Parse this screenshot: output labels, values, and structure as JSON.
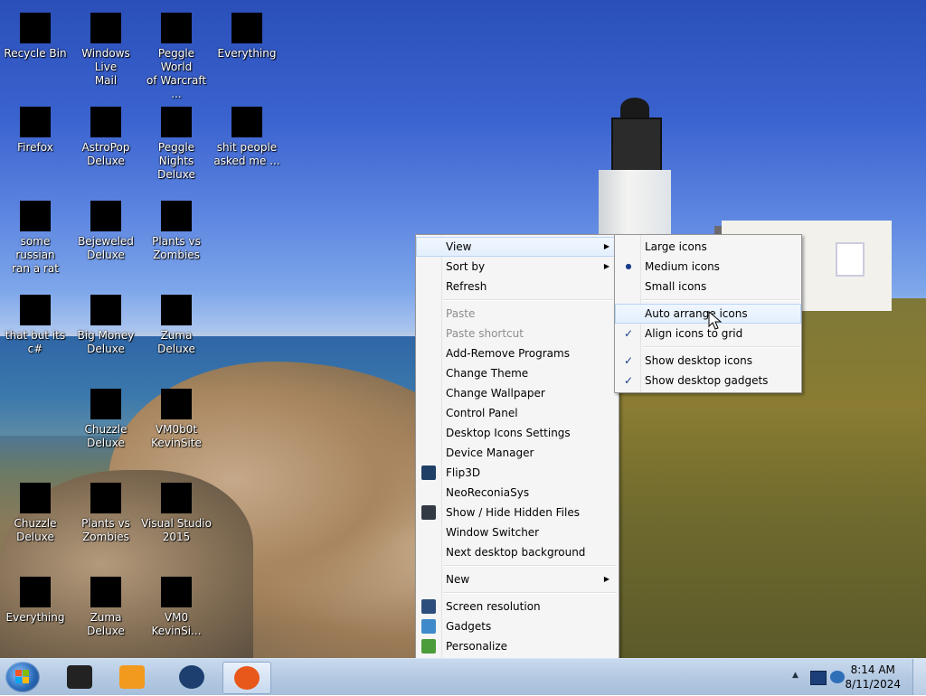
{
  "desktop_icons": [
    {
      "name": "Recycle Bin",
      "color": "#1b1b1b"
    },
    {
      "name": "Windows Live\nMail",
      "color": "#000000"
    },
    {
      "name": "Peggle World\nof Warcraft ...",
      "color": "#d87a1a"
    },
    {
      "name": "Everything",
      "color": "#f07a18"
    },
    {
      "name": "Firefox",
      "color": "#e8741a"
    },
    {
      "name": "AstroPop\nDeluxe",
      "color": "#c62a2a"
    },
    {
      "name": "Peggle Nights\nDeluxe",
      "color": "#3b84c9"
    },
    {
      "name": "shit people\nasked me ...",
      "color": "#777777"
    },
    {
      "name": "some russian\nran a rat",
      "color": "#e8a21a"
    },
    {
      "name": "Bejeweled\nDeluxe",
      "color": "#2a9bd8"
    },
    {
      "name": "Plants vs\nZombies",
      "color": "#6aa84f"
    },
    {
      "name": "that but its c#",
      "color": "#888888"
    },
    {
      "name": "Big Money\nDeluxe",
      "color": "#c8a23a"
    },
    {
      "name": "Zuma Deluxe",
      "color": "#d89a22"
    },
    {
      "name": "Chuzzle\nDeluxe",
      "color": "#d8442a"
    },
    {
      "name": "VM0b0t\nKevinSite",
      "color": "#2a8a6a"
    },
    {
      "name": "Chuzzle\nDeluxe",
      "color": "#d8442a"
    },
    {
      "name": "Plants vs\nZombies",
      "color": "#6aa84f"
    },
    {
      "name": "Visual Studio\n2015",
      "color": "#68217a"
    },
    {
      "name": "Everything",
      "color": "#f07a18"
    },
    {
      "name": "Zuma Deluxe",
      "color": "#d89a22"
    },
    {
      "name": "VM0\nKevinSi...",
      "color": "#68217a"
    }
  ],
  "context_menu": {
    "items": [
      {
        "label": "View",
        "submenu": true,
        "highlighted": true
      },
      {
        "label": "Sort by",
        "submenu": true
      },
      {
        "label": "Refresh"
      },
      {
        "sep": true
      },
      {
        "label": "Paste",
        "disabled": true
      },
      {
        "label": "Paste shortcut",
        "disabled": true
      },
      {
        "label": "Add-Remove Programs"
      },
      {
        "label": "Change Theme"
      },
      {
        "label": "Change Wallpaper"
      },
      {
        "label": "Control Panel"
      },
      {
        "label": "Desktop Icons Settings"
      },
      {
        "label": "Device Manager"
      },
      {
        "label": "Flip3D",
        "icon": "flip3d-icon",
        "icon_color": "#1f3f66"
      },
      {
        "label": "NeoReconiaSys"
      },
      {
        "label": "Show / Hide Hidden Files",
        "icon": "hidden-files-icon",
        "icon_color": "#333a44"
      },
      {
        "label": "Window Switcher"
      },
      {
        "label": "Next desktop background"
      },
      {
        "sep": true
      },
      {
        "label": "New",
        "submenu": true
      },
      {
        "sep": true
      },
      {
        "label": "Screen resolution",
        "icon": "screen-resolution-icon",
        "icon_color": "#2c4e7c"
      },
      {
        "label": "Gadgets",
        "icon": "gadgets-icon",
        "icon_color": "#3f8acb"
      },
      {
        "label": "Personalize",
        "icon": "personalize-icon",
        "icon_color": "#4b9c3a"
      }
    ]
  },
  "view_submenu": {
    "items": [
      {
        "label": "Large icons"
      },
      {
        "label": "Medium icons",
        "mark": "●"
      },
      {
        "label": "Small icons"
      },
      {
        "sep": true
      },
      {
        "label": "Auto arrange icons",
        "highlighted": true
      },
      {
        "label": "Align icons to grid",
        "mark": "✓"
      },
      {
        "sep": true
      },
      {
        "label": "Show desktop icons",
        "mark": "✓"
      },
      {
        "label": "Show desktop gadgets",
        "mark": "✓"
      }
    ]
  },
  "taskbar": {
    "buttons": [
      {
        "name": "taskbar-app-1",
        "color": "#222222"
      },
      {
        "name": "taskbar-media-player",
        "color": "#f29a1e"
      },
      {
        "name": "taskbar-globe-app",
        "color": "#1d3f70"
      },
      {
        "name": "taskbar-firefox",
        "color": "#e8581a",
        "active": true
      }
    ],
    "clock_time": "8:14 AM",
    "clock_date": "8/11/2024"
  }
}
